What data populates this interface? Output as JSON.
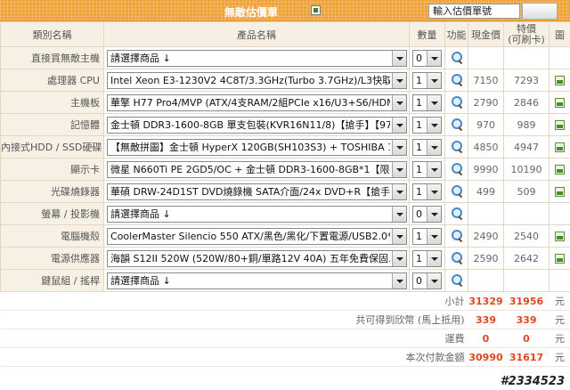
{
  "header": {
    "title": "無敵估價單",
    "quote_input_value": "輸入估價單號"
  },
  "columns": {
    "category": "類別名稱",
    "product": "產品名稱",
    "qty": "數量",
    "function": "功能",
    "cash_price": "現金價",
    "special_price_line1": "特價",
    "special_price_line2": "(可刷卡)",
    "picture": "圖"
  },
  "rows": [
    {
      "category": "直接買無敵主機",
      "product": "請選擇商品 ↓",
      "qty": "0",
      "cash": "",
      "special": ""
    },
    {
      "category": "處理器 CPU",
      "product": "Intel Xeon E3-1230V2 4C8T/3.3GHz(Turbo 3.7GHz)/L3快取8MB/無顯",
      "qty": "1",
      "cash": "7150",
      "special": "7293"
    },
    {
      "category": "主機板",
      "product": "華擎 H77 Pro4/MVP (ATX/4支RAM/2組PCIe x16/U3+S6/HDMI+DVI",
      "qty": "1",
      "cash": "2790",
      "special": "2846"
    },
    {
      "category": "記憶體",
      "product": "金士頓 DDR3-1600-8GB 單支包裝(KVR16N11/8)【搶手】【970元",
      "qty": "1",
      "cash": "970",
      "special": "989"
    },
    {
      "category": "內接式HDD / SSD硬碟",
      "product": "【無敵拼圖】金士頓 HyperX 120GB(SH103S3) + TOSHIBA 1TB ★超",
      "qty": "1",
      "cash": "4850",
      "special": "4947"
    },
    {
      "category": "顯示卡",
      "product": "微星 N660Ti PE 2GD5/OC + 金士頓 DDR3-1600-8GB*1【限量】【S",
      "qty": "1",
      "cash": "9990",
      "special": "10190"
    },
    {
      "category": "光碟燒錄器",
      "product": "華碩 DRW-24D1ST DVD燒錄機 SATA介面/24x DVD+R【搶手】【4",
      "qty": "1",
      "cash": "499",
      "special": "509"
    },
    {
      "category": "螢幕 / 投影機",
      "product": "請選擇商品 ↓",
      "qty": "0",
      "cash": "",
      "special": ""
    },
    {
      "category": "電腦機殼",
      "product": "CoolerMaster Silencio 550 ATX/黑色/黑化/下置電源/USB2.0*1/USB",
      "qty": "1",
      "cash": "2490",
      "special": "2540"
    },
    {
      "category": "電源供應器",
      "product": "海韻 S12II 520W (520W/80+銅/單路12V 40A) 五年免費保固.九十天",
      "qty": "1",
      "cash": "2590",
      "special": "2642"
    },
    {
      "category": "鍵鼠組 / 搖桿",
      "product": "請選擇商品 ↓",
      "qty": "0",
      "cash": "",
      "special": ""
    }
  ],
  "summary": {
    "subtotal_label": "小計",
    "subtotal_cash": "31329",
    "subtotal_special": "31956",
    "points_label": "共可得到欣幣 (馬上抵用)",
    "points_cash": "339",
    "points_special": "339",
    "shipping_label": "運費",
    "shipping_cash": "0",
    "shipping_special": "0",
    "total_label": "本次付款金額",
    "total_cash": "30990",
    "total_special": "31617",
    "unit": "元"
  },
  "watermark": "#2334523",
  "colors": {
    "banner": "#f0a23a",
    "accent_red": "#e2461f",
    "header_bg": "#f5f0e3",
    "border": "#e4d6bf"
  },
  "icons": {
    "function": "magnifier-icon",
    "picture": "picture-icon"
  }
}
